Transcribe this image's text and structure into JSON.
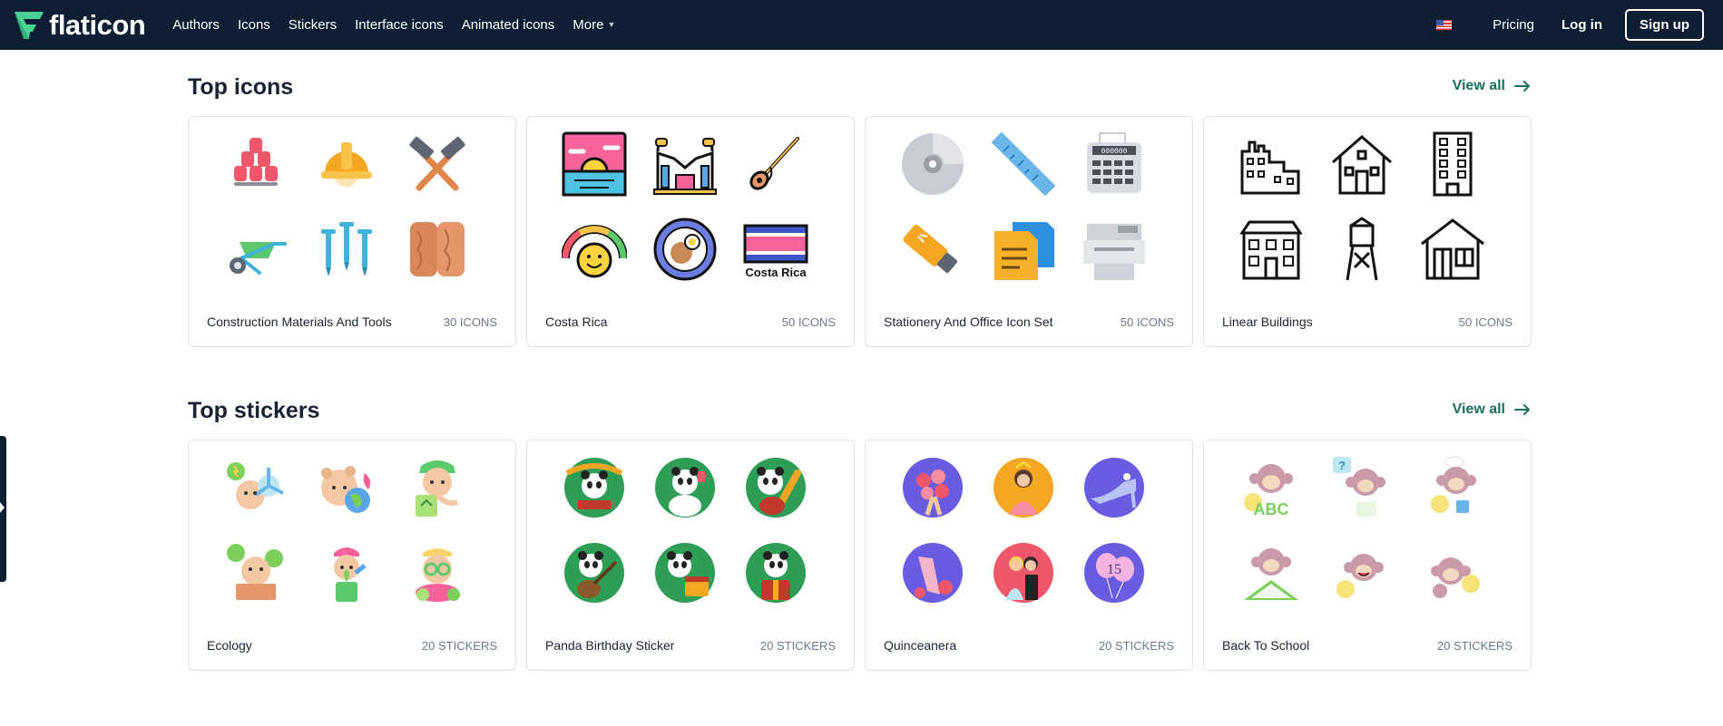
{
  "nav": {
    "logo_text": "flaticon",
    "links": [
      {
        "label": "Authors"
      },
      {
        "label": "Icons"
      },
      {
        "label": "Stickers"
      },
      {
        "label": "Interface icons"
      },
      {
        "label": "Animated icons"
      },
      {
        "label": "More"
      }
    ],
    "pricing": "Pricing",
    "login": "Log in",
    "signup": "Sign up"
  },
  "top_icons": {
    "title": "Top icons",
    "view_all": "View all",
    "cards": [
      {
        "name": "Construction Materials And Tools",
        "count": "30 ICONS"
      },
      {
        "name": "Costa Rica",
        "count": "50 ICONS",
        "sign_text": "Costa Rica"
      },
      {
        "name": "Stationery And Office Icon Set",
        "count": "50 ICONS",
        "register_text": "000000"
      },
      {
        "name": "Linear Buildings",
        "count": "50 ICONS"
      }
    ]
  },
  "top_stickers": {
    "title": "Top stickers",
    "view_all": "View all",
    "cards": [
      {
        "name": "Ecology",
        "count": "20 STICKERS"
      },
      {
        "name": "Panda Birthday Sticker",
        "count": "20 STICKERS"
      },
      {
        "name": "Quinceanera",
        "count": "20 STICKERS",
        "balloon_text": "15"
      },
      {
        "name": "Back To School",
        "count": "20 STICKERS",
        "block_text": "ABC"
      }
    ]
  },
  "colors": {
    "nav_bg": "#0e1f33",
    "accent": "#1a6f5e",
    "card_border": "#dde2e8",
    "muted_text": "#6a7a8c"
  }
}
